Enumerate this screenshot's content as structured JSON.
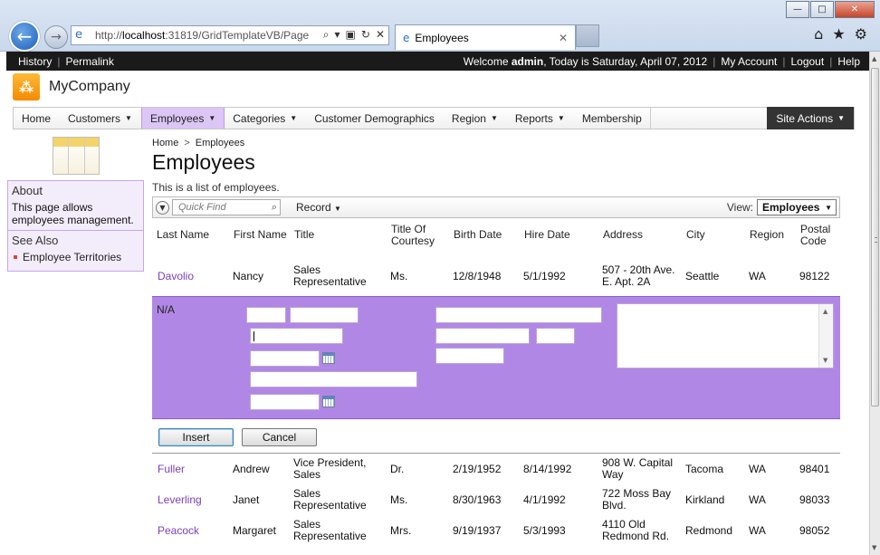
{
  "browser": {
    "url_prefix": "http://",
    "url_host": "localhost",
    "url_rest": ":31819/GridTemplateVB/Page",
    "tab_title": "Employees",
    "minimize": "—",
    "maximize": "□",
    "close": "✕"
  },
  "topbar": {
    "history": "History",
    "permalink": "Permalink",
    "welcome_prefix": "Welcome ",
    "user": "admin",
    "welcome_suffix": ", Today is Saturday, April 07, 2012",
    "my_account": "My Account",
    "logout": "Logout",
    "help": "Help"
  },
  "brand": {
    "name": "MyCompany"
  },
  "menu": {
    "items": [
      "Home",
      "Customers",
      "Employees",
      "Categories",
      "Customer Demographics",
      "Region",
      "Reports",
      "Membership"
    ],
    "site_actions": "Site Actions"
  },
  "sidebar": {
    "about_title": "About",
    "about_text": "This page allows employees management.",
    "see_also_title": "See Also",
    "link": "Employee Territories"
  },
  "page": {
    "crumb_home": "Home",
    "crumb_sep": ">",
    "crumb_current": "Employees",
    "title": "Employees",
    "description": "This is a list of employees."
  },
  "toolbar": {
    "quick_find": "Quick Find",
    "record": "Record",
    "view_label": "View:",
    "view_value": "Employees"
  },
  "grid": {
    "headers": [
      "Last Name",
      "First Name",
      "Title",
      "Title Of Courtesy",
      "Birth Date",
      "Hire Date",
      "Address",
      "City",
      "Region",
      "Postal Code"
    ],
    "row_first": {
      "last": "Davolio",
      "first": "Nancy",
      "title": "Sales Representative",
      "courtesy": "Ms.",
      "birth": "12/8/1948",
      "hire": "5/1/1992",
      "address": "507 - 20th Ave. E. Apt. 2A",
      "city": "Seattle",
      "region": "WA",
      "postal": "98122"
    },
    "new_row_label": "N/A",
    "rows": [
      {
        "last": "Fuller",
        "first": "Andrew",
        "title": "Vice President, Sales",
        "courtesy": "Dr.",
        "birth": "2/19/1952",
        "hire": "8/14/1992",
        "address": "908 W. Capital Way",
        "city": "Tacoma",
        "region": "WA",
        "postal": "98401"
      },
      {
        "last": "Leverling",
        "first": "Janet",
        "title": "Sales Representative",
        "courtesy": "Ms.",
        "birth": "8/30/1963",
        "hire": "4/1/1992",
        "address": "722 Moss Bay Blvd.",
        "city": "Kirkland",
        "region": "WA",
        "postal": "98033"
      },
      {
        "last": "Peacock",
        "first": "Margaret",
        "title": "Sales Representative",
        "courtesy": "Mrs.",
        "birth": "9/19/1937",
        "hire": "5/3/1993",
        "address": "4110 Old Redmond Rd.",
        "city": "Redmond",
        "region": "WA",
        "postal": "98052"
      }
    ]
  },
  "actions": {
    "insert": "Insert",
    "cancel": "Cancel"
  }
}
